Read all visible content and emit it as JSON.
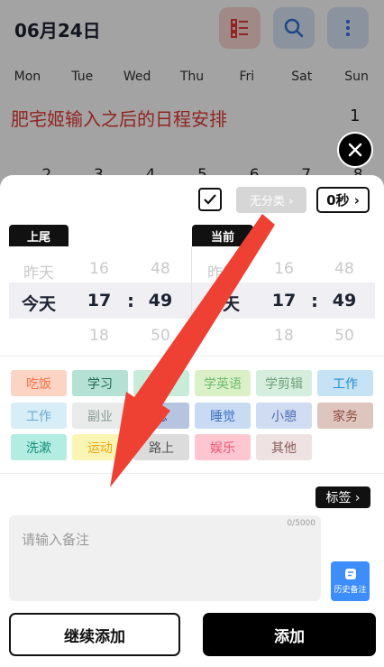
{
  "header": {
    "title": "06月24日"
  },
  "weekdays": [
    "Mon",
    "Tue",
    "Wed",
    "Thu",
    "Fri",
    "Sat",
    "Sun"
  ],
  "annotation": "肥宅姬输入之后的日程安排",
  "calendar": {
    "row1_date": "1",
    "row2_dates": [
      "2",
      "3",
      "4",
      "5",
      "6",
      "7",
      "8"
    ]
  },
  "sheet": {
    "category_label": "无分类 ›",
    "seconds_label": "0秒 ›",
    "left_picker": {
      "tab": "上尾",
      "day_prev": "昨天",
      "day_sel": "今天",
      "hour_prev": "16",
      "hour_sel": "17",
      "hour_next": "18",
      "min_prev": "48",
      "min_sel": "49",
      "min_next": "50"
    },
    "right_picker": {
      "tab": "当前",
      "day_prev": "昨天",
      "day_sel": "今天",
      "hour_prev": "16",
      "hour_sel": "17",
      "hour_next": "18",
      "min_prev": "48",
      "min_sel": "49",
      "min_next": "50"
    },
    "colon": ":",
    "tags": [
      "吃饭",
      "学习",
      "学编",
      "学英语",
      "学剪辑",
      "工作",
      "工作",
      "副业",
      "息",
      "睡觉",
      "小憩",
      "家务",
      "洗漱",
      "运动",
      "路上",
      "娱乐",
      "其他"
    ],
    "label_button": "标签 ›",
    "note_placeholder": "请输入备注",
    "note_counter": "0/5000",
    "history_button": "历史备注",
    "continue_button": "继续添加",
    "add_button": "添加"
  },
  "colors": {
    "accent_red": "#e53935",
    "arrow_red": "#ef4034",
    "history_blue": "#3d8dfb",
    "tag_backgrounds": [
      "#fbd4c4",
      "#b5e1d5",
      "#c8ecda",
      "#dcf0c8",
      "#d6eede",
      "#c6e3f5",
      "#d7eef8",
      "#e8ebea",
      "#b7c4df",
      "#c9dbf3",
      "#d0dcf2",
      "#dec6bf",
      "#b3ece0",
      "#fbf5b4",
      "#dcdcdc",
      "#fdc6d1",
      "#efe2e2"
    ],
    "tag_text": [
      "#ff7043",
      "#1b6b52",
      "#5bb78c",
      "#6dbc6b",
      "#6ea07b",
      "#1f8fd4",
      "#69a8cc",
      "#8a9b94",
      "#3b4f80",
      "#3a6fc4",
      "#4b6fb3",
      "#8d4a3c",
      "#0f8f78",
      "#f0a30a",
      "#555555",
      "#e85575",
      "#8a5b5b"
    ]
  },
  "icons": [
    "list-toggle-icon",
    "search-icon",
    "more-vertical-icon",
    "close-icon",
    "check-icon",
    "chevron-right-icon",
    "history-note-icon",
    "red-arrow"
  ]
}
